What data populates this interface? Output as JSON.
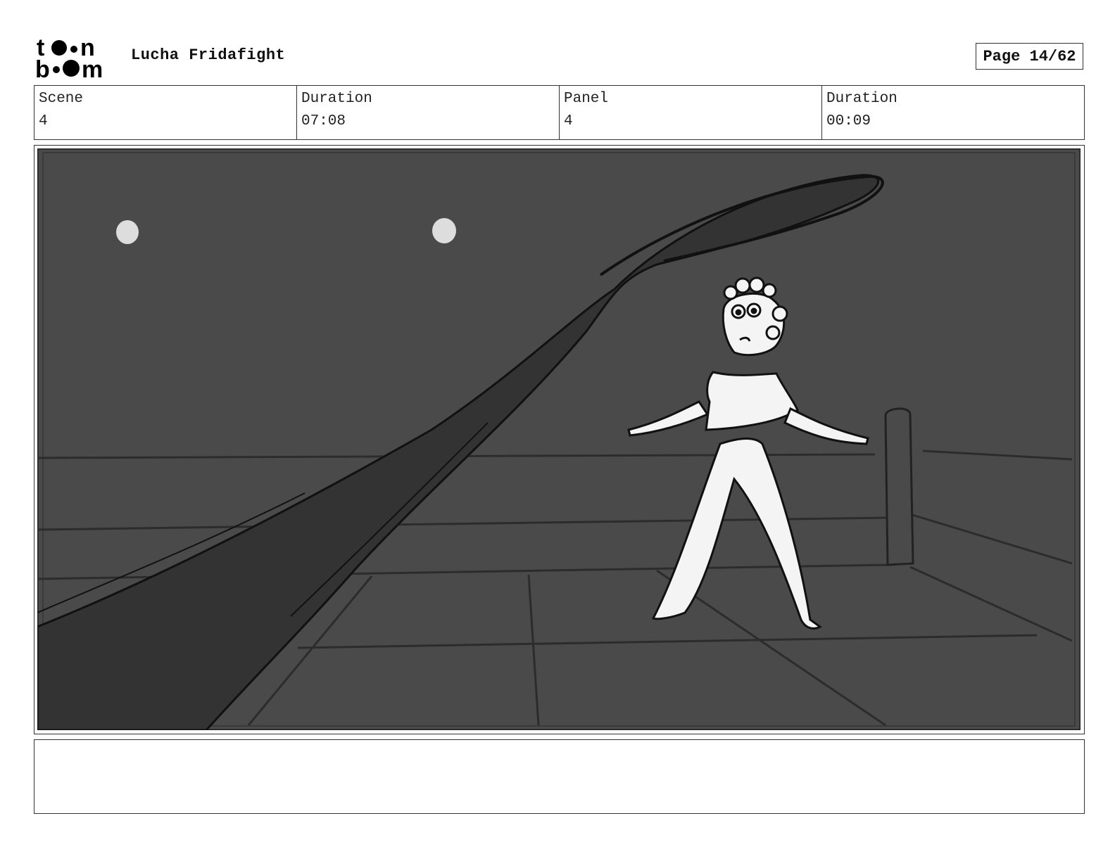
{
  "header": {
    "logo_text": [
      "to•n",
      "b••m"
    ],
    "project_title": "Lucha Fridafight",
    "page_label": "Page 14/62"
  },
  "info": {
    "scene_label": "Scene",
    "scene_value": "4",
    "scene_duration_label": "Duration",
    "scene_duration_value": "07:08",
    "panel_label": "Panel",
    "panel_value": "4",
    "panel_duration_label": "Duration",
    "panel_duration_value": "00:09"
  },
  "panel_image": {
    "description_icon": "storyboard-sketch-icon",
    "colors": {
      "background": "#4a4a4a",
      "shadow": "#333333",
      "line": "#111111",
      "figure": "#f4f4f4",
      "moon": "#dddddd"
    }
  },
  "notes": {
    "text": ""
  }
}
